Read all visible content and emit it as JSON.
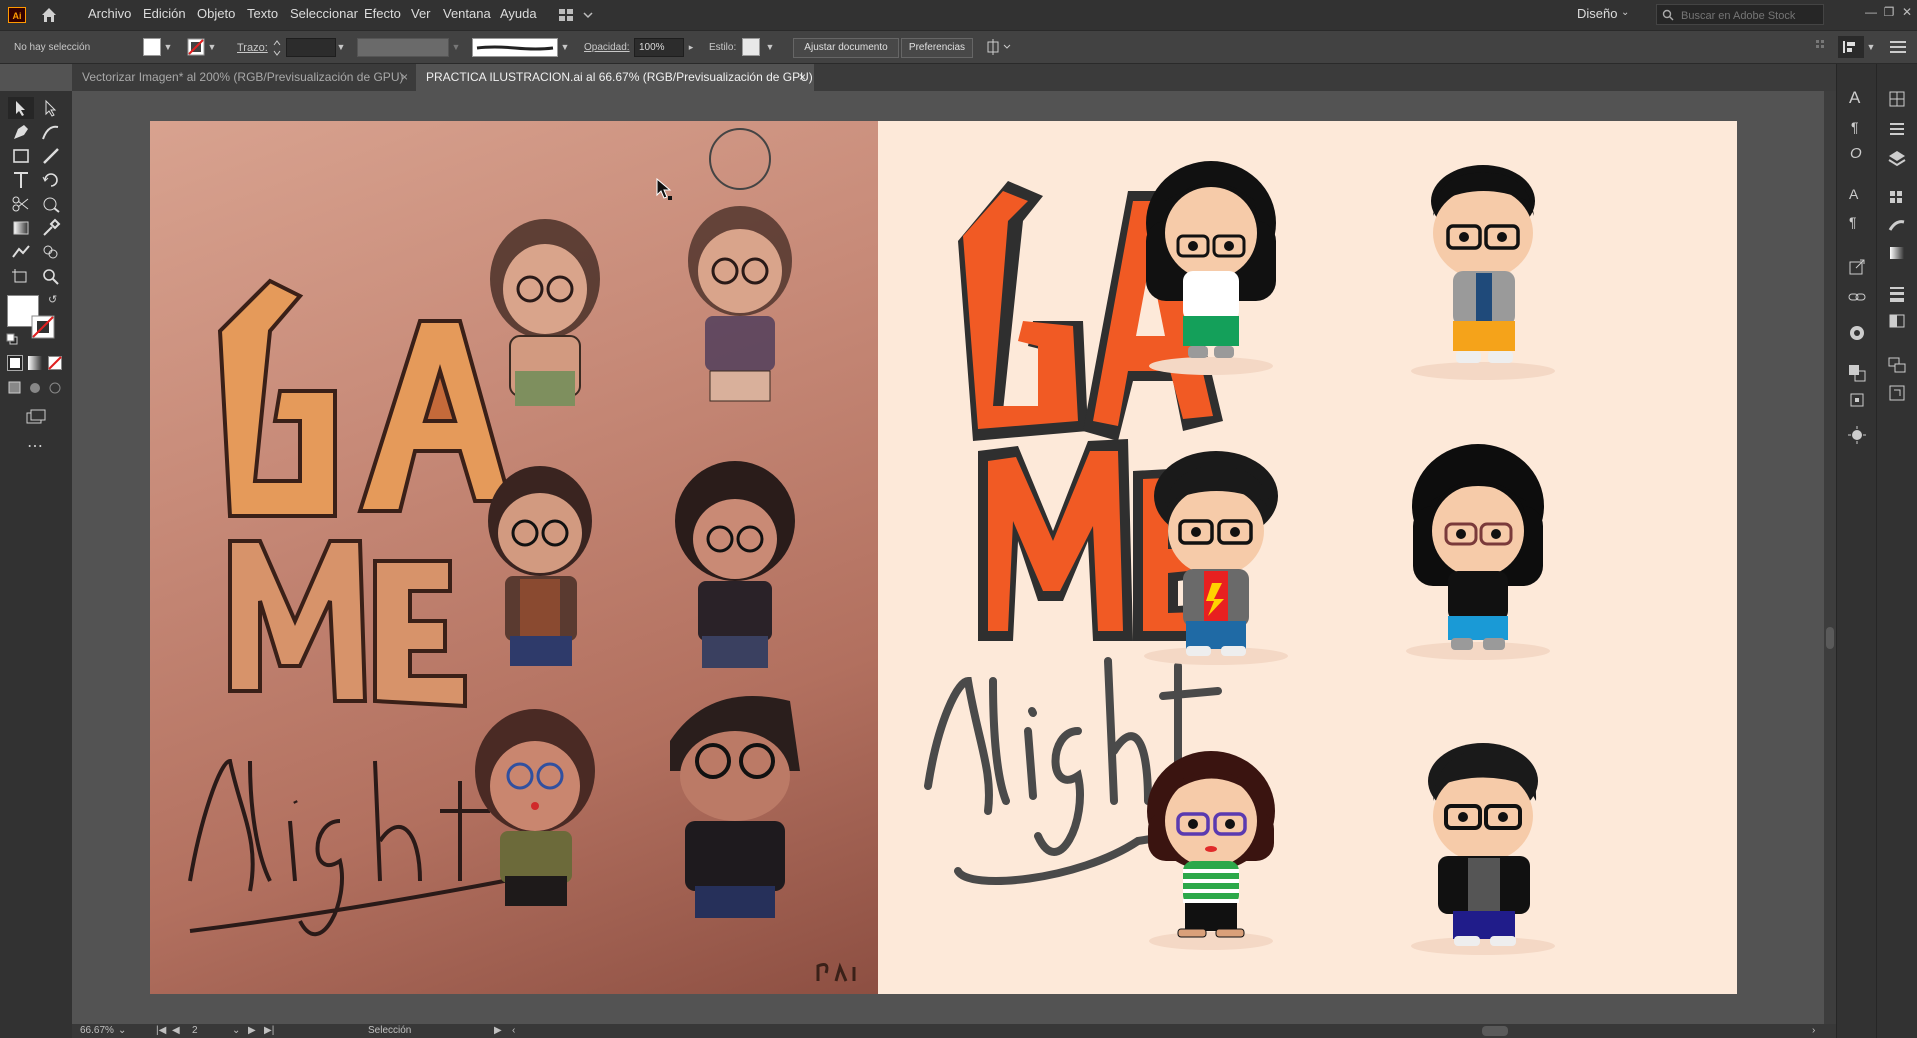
{
  "app": {
    "logo": "Ai"
  },
  "menu": [
    "Archivo",
    "Edición",
    "Objeto",
    "Texto",
    "Seleccionar",
    "Efecto",
    "Ver",
    "Ventana",
    "Ayuda"
  ],
  "workspace": {
    "label": "Diseño"
  },
  "search": {
    "placeholder": "Buscar en Adobe Stock"
  },
  "control": {
    "selection_status": "No hay selección",
    "stroke_label": "Trazo:",
    "opacity_label": "Opacidad:",
    "opacity_value": "100%",
    "style_label": "Estilo:",
    "fit_button": "Ajustar documento",
    "prefs_button": "Preferencias"
  },
  "tabs": [
    {
      "label": "Vectorizar Imagen* al 200% (RGB/Previsualización de GPU)",
      "close": "×",
      "active": false
    },
    {
      "label": "PRACTICA ILUSTRACION.ai al 66.67% (RGB/Previsualización de GPU)",
      "close": "×",
      "active": true
    }
  ],
  "artwork": {
    "photo_text": [
      "GA",
      "ME",
      "Night"
    ],
    "vector_text": [
      "GA",
      "ME",
      "Night"
    ]
  },
  "status": {
    "zoom": "66.67%",
    "artboard": "2",
    "mode": "Selección"
  },
  "colors": {
    "accent": "#ff9a00",
    "art_orange": "#f15a24",
    "art_dark": "#333333",
    "art_bg": "#fde9d9"
  }
}
